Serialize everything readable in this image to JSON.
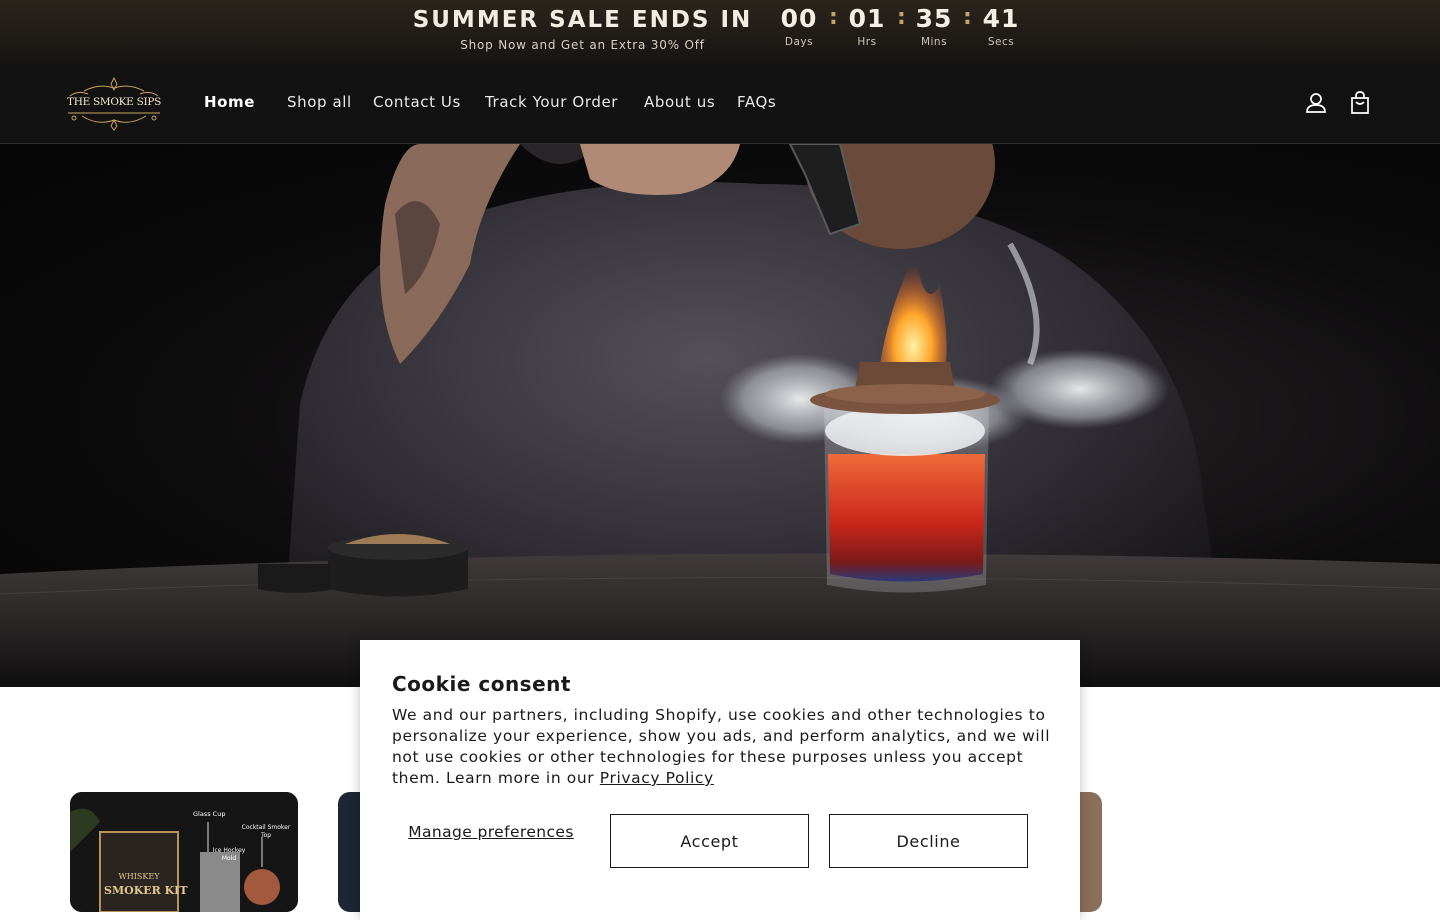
{
  "announcement": {
    "title": "SUMMER SALE ENDS IN",
    "subtitle": "Shop Now and Get an Extra 30% Off",
    "countdown": [
      {
        "value": "00",
        "label": "Days"
      },
      {
        "value": "01",
        "label": "Hrs"
      },
      {
        "value": "35",
        "label": "Mins"
      },
      {
        "value": "41",
        "label": "Secs"
      }
    ],
    "separator": ":"
  },
  "header": {
    "logo_text": "THE SMOKE SIPS",
    "nav": [
      {
        "label": "Home",
        "active": true
      },
      {
        "label": "Shop all"
      },
      {
        "label": "Contact Us"
      },
      {
        "label": "Track Your Order"
      },
      {
        "label": "About us"
      },
      {
        "label": "FAQs"
      }
    ],
    "icons": [
      "account-icon",
      "cart-icon"
    ]
  },
  "hero": {
    "image": "bartender-torching-smoked-cocktail"
  },
  "products": {
    "card_1_text": [
      "Glass Cup",
      "Cocktail Smoker Top",
      "Ice Hockey Mold",
      "WHISKEY",
      "SMOKER KIT"
    ]
  },
  "cookie": {
    "title": "Cookie consent",
    "body": "We and our partners, including Shopify, use cookies and other technologies to personalize your experience, show you ads, and perform analytics, and we will not use cookies or other technologies for these purposes unless you accept them. Learn more in our",
    "link": "Privacy Policy",
    "manage_label": "Manage preferences",
    "accept_label": "Accept",
    "decline_label": "Decline"
  },
  "colors": {
    "announce_bg": "#1f1b17",
    "header_bg": "#121212",
    "gold_accent": "#c4a46a",
    "cocktail": "#d8371f"
  }
}
